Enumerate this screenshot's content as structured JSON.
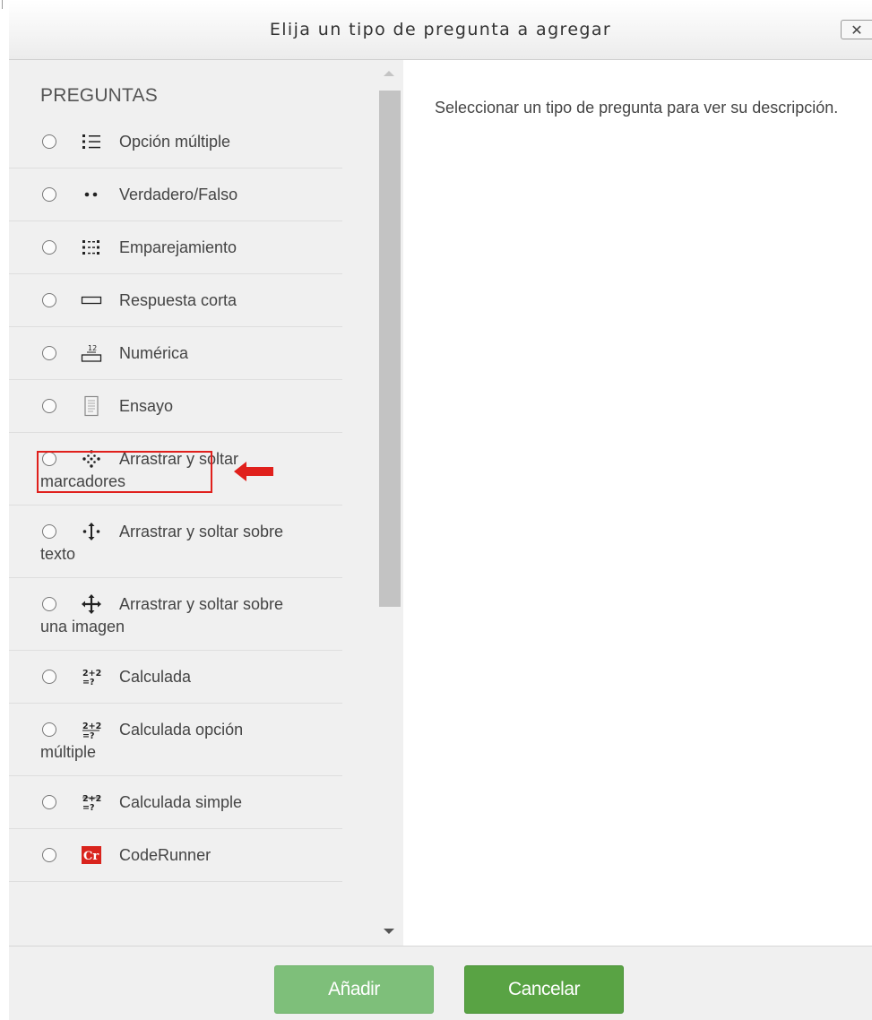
{
  "dialog": {
    "title": "Elija un tipo de pregunta a agregar",
    "close_label": "✕"
  },
  "left_pane": {
    "heading": "PREGUNTAS",
    "options": [
      {
        "label": "Opción múltiple",
        "icon": "multiple-choice-icon"
      },
      {
        "label": "Verdadero/Falso",
        "icon": "true-false-icon"
      },
      {
        "label": "Emparejamiento",
        "icon": "matching-icon"
      },
      {
        "label": "Respuesta corta",
        "icon": "short-answer-icon"
      },
      {
        "label": "Numérica",
        "icon": "numerical-icon"
      },
      {
        "label": "Ensayo",
        "icon": "essay-icon",
        "highlighted": true
      },
      {
        "label": "Arrastrar y soltar",
        "label_cont": "marcadores",
        "icon": "drag-drop-markers-icon"
      },
      {
        "label": "Arrastrar y soltar sobre",
        "label_cont": "texto",
        "icon": "drag-drop-text-icon"
      },
      {
        "label": "Arrastrar y soltar sobre",
        "label_cont": "una imagen",
        "icon": "drag-drop-image-icon"
      },
      {
        "label": "Calculada",
        "icon": "calculated-icon",
        "icon_text": "2+2 =?"
      },
      {
        "label": "Calculada opción",
        "label_cont": "múltiple",
        "icon": "calculated-multichoice-icon",
        "icon_text": "2+2 =?"
      },
      {
        "label": "Calculada simple",
        "icon": "calculated-simple-icon",
        "icon_text": "2+2 =?"
      },
      {
        "label": "CodeRunner",
        "icon": "coderunner-icon",
        "icon_text": "Cr"
      }
    ]
  },
  "right_pane": {
    "description": "Seleccionar un tipo de pregunta para ver su descripción."
  },
  "footer": {
    "add_label": "Añadir",
    "cancel_label": "Cancelar"
  },
  "colors": {
    "highlight_border": "#e0201c",
    "pointer_arrow": "#e0201c",
    "add_button": "#7ebf7a",
    "cancel_button": "#59a344",
    "coderunner_icon": "#d9241d"
  }
}
